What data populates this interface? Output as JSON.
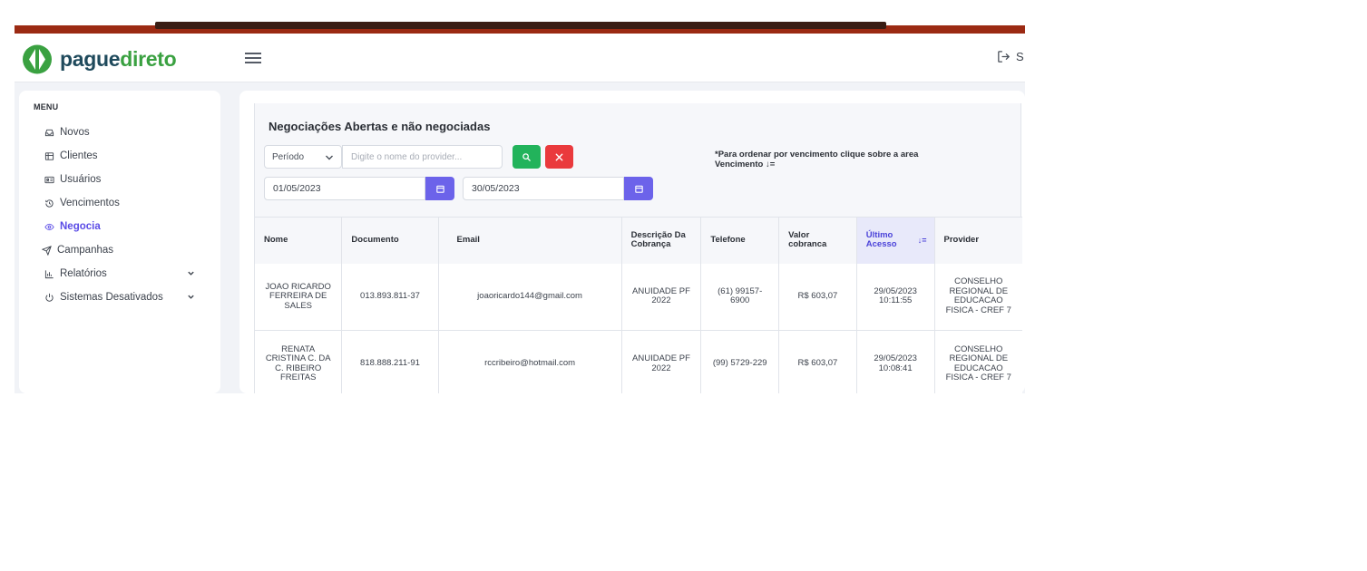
{
  "header": {
    "logo_left": "pague",
    "logo_right": "direto",
    "logout_label": "S"
  },
  "sidebar": {
    "menu_title": "MENU",
    "items": [
      {
        "label": "Novos",
        "icon": "inbox-icon"
      },
      {
        "label": "Clientes",
        "icon": "clients-icon"
      },
      {
        "label": "Usuários",
        "icon": "users-card-icon"
      },
      {
        "label": "Vencimentos",
        "icon": "history-icon"
      },
      {
        "label": "Negocia",
        "icon": "eye-icon",
        "active": true
      },
      {
        "label": "Campanhas",
        "icon": "send-icon"
      },
      {
        "label": "Relatórios",
        "icon": "chart-icon",
        "has_submenu": true
      },
      {
        "label": "Sistemas Desativados",
        "icon": "power-icon",
        "has_submenu": true
      }
    ]
  },
  "main": {
    "title": "Negociações Abertas e não negociadas",
    "period_select": "Período",
    "provider_placeholder": "Digite o nome do provider...",
    "order_hint": "*Para ordenar por vencimento clique sobre a area Vencimento ↓=",
    "date_start": "01/05/2023",
    "date_end": "30/05/2023",
    "table": {
      "headers": [
        "Nome",
        "Documento",
        "Email",
        "Descrição Da Cobrança",
        "Telefone",
        "Valor cobranca",
        "Último Acesso",
        "Provider"
      ],
      "sorted_column": "Último Acesso",
      "sort_icon": "↓=",
      "rows": [
        [
          "JOAO RICARDO FERREIRA DE SALES",
          "013.893.811-37",
          "joaoricardo144@gmail.com",
          "ANUIDADE PF 2022",
          "(61) 99157-6900",
          "R$ 603,07",
          "29/05/2023 10:11:55",
          "CONSELHO REGIONAL DE EDUCACAO FISICA - CREF 7"
        ],
        [
          "RENATA CRISTINA C. DA C. RIBEIRO FREITAS",
          "818.888.211-91",
          "rccribeiro@hotmail.com",
          "ANUIDADE PF 2022",
          "(99) 5729-229",
          "R$ 603,07",
          "29/05/2023 10:08:41",
          "CONSELHO REGIONAL DE EDUCACAO FISICA - CREF 7"
        ]
      ]
    }
  },
  "colors": {
    "brand_dark": "#1f4a5c",
    "brand_green": "#3aa141",
    "accent": "#5b4ce6",
    "search_button": "#22b35b",
    "clear_button": "#ea3a3d",
    "date_button": "#6c63ea"
  }
}
